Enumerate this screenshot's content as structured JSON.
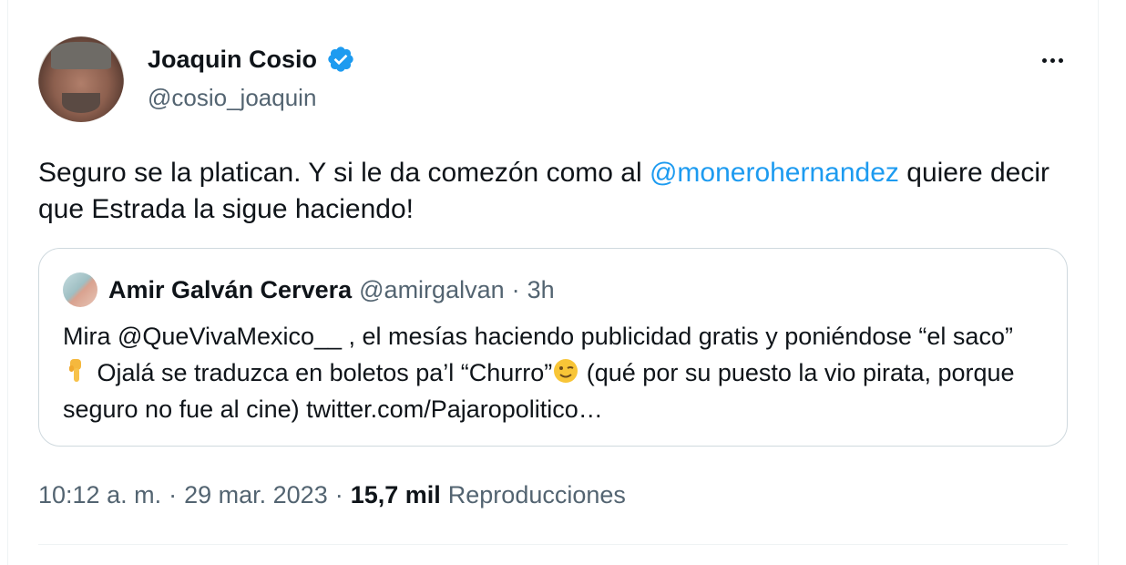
{
  "tweet": {
    "author": {
      "name": "Joaquin Cosio",
      "handle": "@cosio_joaquin"
    },
    "text_part1": "Seguro se la platican. Y si le da comezón como al ",
    "mention": "@monerohernandez",
    "text_part2": " quiere decir que Estrada la sigue haciendo!",
    "quote": {
      "author_name": "Amir Galván Cervera",
      "author_handle": "@amirgalvan",
      "separator": "·",
      "time": "3h",
      "text_a": "Mira @QueVivaMexico__ , el mesías haciendo publicidad gratis y poniéndose “el saco” ",
      "emoji_1": "pointing-down-hand-emoji",
      "text_b": " Ojalá se traduzca en boletos pa’l “Churro”",
      "emoji_2": "winking-face-emoji",
      "text_c": " (qué por su puesto la vio pirata, porque seguro no fue al cine) twitter.com/Pajaropolitico…"
    },
    "meta": {
      "time": "10:12 a. m.",
      "sep1": "·",
      "date": "29 mar. 2023",
      "sep2": "·",
      "views_count": "15,7 mil",
      "views_label": "Reproducciones"
    }
  },
  "colors": {
    "link": "#1d9bf0",
    "secondary_text": "#536471",
    "verified_badge": "#1d9bf0",
    "border": "#cfd9de"
  },
  "icons": {
    "verified": "verified-badge-icon",
    "more": "more-options-icon"
  }
}
